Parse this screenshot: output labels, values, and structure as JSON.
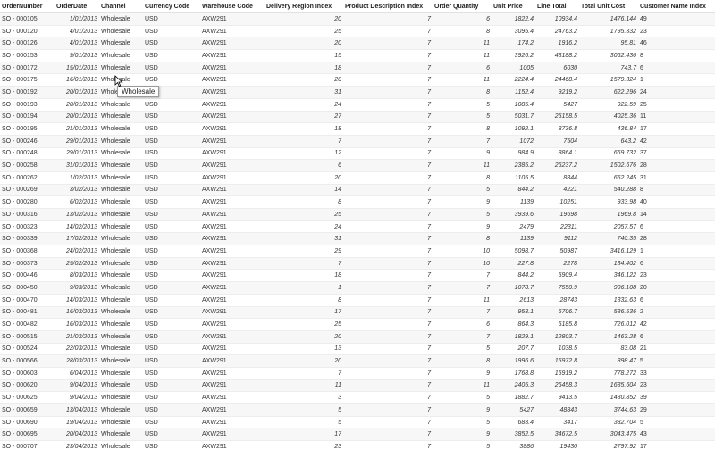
{
  "columns": [
    "OrderNumber",
    "OrderDate",
    "Channel",
    "Currency Code",
    "Warehouse Code",
    "Delivery Region Index",
    "Product Description Index",
    "Order Quantity",
    "Unit Price",
    "Line Total",
    "Total Unit Cost",
    "Customer Name Index"
  ],
  "rows": [
    [
      "SO - 000105",
      "1/01/2013",
      "Wholesale",
      "USD",
      "AXW291",
      "20",
      "7",
      "6",
      "1822.4",
      "10934.4",
      "1476.144",
      "49"
    ],
    [
      "SO - 000120",
      "4/01/2013",
      "Wholesale",
      "USD",
      "AXW291",
      "25",
      "7",
      "8",
      "3095.4",
      "24763.2",
      "1795.332",
      "23"
    ],
    [
      "SO - 000126",
      "4/01/2013",
      "Wholesale",
      "USD",
      "AXW291",
      "20",
      "7",
      "11",
      "174.2",
      "1916.2",
      "95.81",
      "46"
    ],
    [
      "SO - 000153",
      "9/01/2013",
      "Wholesale",
      "USD",
      "AXW291",
      "15",
      "7",
      "11",
      "3926.2",
      "43188.2",
      "3062.436",
      "8"
    ],
    [
      "SO - 000172",
      "15/01/2013",
      "Wholesale",
      "USD",
      "AXW291",
      "18",
      "7",
      "6",
      "1005",
      "6030",
      "743.7",
      "6"
    ],
    [
      "SO - 000175",
      "16/01/2013",
      "Wholesale",
      "USD",
      "AXW291",
      "20",
      "7",
      "11",
      "2224.4",
      "24468.4",
      "1579.324",
      "1"
    ],
    [
      "SO - 000192",
      "20/01/2013",
      "Wholesale",
      "USD",
      "AXW291",
      "31",
      "7",
      "8",
      "1152.4",
      "9219.2",
      "622.296",
      "24"
    ],
    [
      "SO - 000193",
      "20/01/2013",
      "Wholesale",
      "USD",
      "AXW291",
      "24",
      "7",
      "5",
      "1085.4",
      "5427",
      "922.59",
      "25"
    ],
    [
      "SO - 000194",
      "20/01/2013",
      "Wholesale",
      "USD",
      "AXW291",
      "27",
      "7",
      "5",
      "5031.7",
      "25158.5",
      "4025.36",
      "11"
    ],
    [
      "SO - 000195",
      "21/01/2013",
      "Wholesale",
      "USD",
      "AXW291",
      "18",
      "7",
      "8",
      "1092.1",
      "8736.8",
      "436.84",
      "17"
    ],
    [
      "SO - 000246",
      "29/01/2013",
      "Wholesale",
      "USD",
      "AXW291",
      "7",
      "7",
      "7",
      "1072",
      "7504",
      "643.2",
      "42"
    ],
    [
      "SO - 000248",
      "29/01/2013",
      "Wholesale",
      "USD",
      "AXW291",
      "12",
      "7",
      "9",
      "984.9",
      "8864.1",
      "669.732",
      "37"
    ],
    [
      "SO - 000258",
      "31/01/2013",
      "Wholesale",
      "USD",
      "AXW291",
      "6",
      "7",
      "11",
      "2385.2",
      "26237.2",
      "1502.676",
      "28"
    ],
    [
      "SO - 000262",
      "1/02/2013",
      "Wholesale",
      "USD",
      "AXW291",
      "20",
      "7",
      "8",
      "1105.5",
      "8844",
      "652.245",
      "31"
    ],
    [
      "SO - 000269",
      "3/02/2013",
      "Wholesale",
      "USD",
      "AXW291",
      "14",
      "7",
      "5",
      "844.2",
      "4221",
      "540.288",
      "8"
    ],
    [
      "SO - 000280",
      "6/02/2013",
      "Wholesale",
      "USD",
      "AXW291",
      "8",
      "7",
      "9",
      "1139",
      "10251",
      "933.98",
      "40"
    ],
    [
      "SO - 000316",
      "13/02/2013",
      "Wholesale",
      "USD",
      "AXW291",
      "25",
      "7",
      "5",
      "3939.6",
      "19698",
      "1969.8",
      "14"
    ],
    [
      "SO - 000323",
      "14/02/2013",
      "Wholesale",
      "USD",
      "AXW291",
      "24",
      "7",
      "9",
      "2479",
      "22311",
      "2057.57",
      "6"
    ],
    [
      "SO - 000339",
      "17/02/2013",
      "Wholesale",
      "USD",
      "AXW291",
      "31",
      "7",
      "8",
      "1139",
      "9112",
      "740.35",
      "28"
    ],
    [
      "SO - 000368",
      "24/02/2013",
      "Wholesale",
      "USD",
      "AXW291",
      "29",
      "7",
      "10",
      "5098.7",
      "50987",
      "3416.129",
      "1"
    ],
    [
      "SO - 000373",
      "25/02/2013",
      "Wholesale",
      "USD",
      "AXW291",
      "7",
      "7",
      "10",
      "227.8",
      "2278",
      "134.402",
      "6"
    ],
    [
      "SO - 000446",
      "8/03/2013",
      "Wholesale",
      "USD",
      "AXW291",
      "18",
      "7",
      "7",
      "844.2",
      "5909.4",
      "346.122",
      "23"
    ],
    [
      "SO - 000450",
      "9/03/2013",
      "Wholesale",
      "USD",
      "AXW291",
      "1",
      "7",
      "7",
      "1078.7",
      "7550.9",
      "906.108",
      "20"
    ],
    [
      "SO - 000470",
      "14/03/2013",
      "Wholesale",
      "USD",
      "AXW291",
      "8",
      "7",
      "11",
      "2613",
      "28743",
      "1332.63",
      "6"
    ],
    [
      "SO - 000481",
      "16/03/2013",
      "Wholesale",
      "USD",
      "AXW291",
      "17",
      "7",
      "7",
      "958.1",
      "6706.7",
      "536.536",
      "2"
    ],
    [
      "SO - 000482",
      "16/03/2013",
      "Wholesale",
      "USD",
      "AXW291",
      "25",
      "7",
      "6",
      "864.3",
      "5185.8",
      "726.012",
      "42"
    ],
    [
      "SO - 000515",
      "21/03/2013",
      "Wholesale",
      "USD",
      "AXW291",
      "20",
      "7",
      "7",
      "1829.1",
      "12803.7",
      "1463.28",
      "6"
    ],
    [
      "SO - 000524",
      "22/03/2013",
      "Wholesale",
      "USD",
      "AXW291",
      "13",
      "7",
      "5",
      "207.7",
      "1038.5",
      "83.08",
      "21"
    ],
    [
      "SO - 000566",
      "28/03/2013",
      "Wholesale",
      "USD",
      "AXW291",
      "20",
      "7",
      "8",
      "1996.6",
      "15972.8",
      "898.47",
      "5"
    ],
    [
      "SO - 000603",
      "6/04/2013",
      "Wholesale",
      "USD",
      "AXW291",
      "7",
      "7",
      "9",
      "1768.8",
      "15919.2",
      "778.272",
      "33"
    ],
    [
      "SO - 000620",
      "9/04/2013",
      "Wholesale",
      "USD",
      "AXW291",
      "11",
      "7",
      "11",
      "2405.3",
      "26458.3",
      "1635.604",
      "23"
    ],
    [
      "SO - 000625",
      "9/04/2013",
      "Wholesale",
      "USD",
      "AXW291",
      "3",
      "7",
      "5",
      "1882.7",
      "9413.5",
      "1430.852",
      "39"
    ],
    [
      "SO - 000659",
      "13/04/2013",
      "Wholesale",
      "USD",
      "AXW291",
      "5",
      "7",
      "9",
      "5427",
      "48843",
      "3744.63",
      "29"
    ],
    [
      "SO - 000690",
      "19/04/2013",
      "Wholesale",
      "USD",
      "AXW291",
      "5",
      "7",
      "5",
      "683.4",
      "3417",
      "382.704",
      "5"
    ],
    [
      "SO - 000695",
      "20/04/2013",
      "Wholesale",
      "USD",
      "AXW291",
      "17",
      "7",
      "9",
      "3852.5",
      "34672.5",
      "3043.475",
      "43"
    ],
    [
      "SO - 000707",
      "23/04/2013",
      "Wholesale",
      "USD",
      "AXW291",
      "23",
      "7",
      "5",
      "3886",
      "19430",
      "2797.92",
      "17"
    ]
  ],
  "tooltip": {
    "text": "Wholesale"
  }
}
